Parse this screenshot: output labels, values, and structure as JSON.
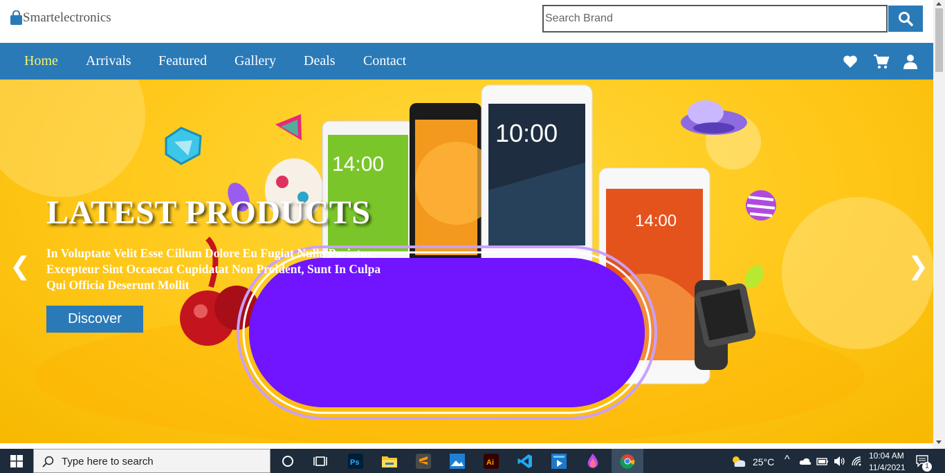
{
  "header": {
    "brand": "Smartelectronics",
    "search_placeholder": "Search Brand"
  },
  "nav": {
    "items": [
      {
        "label": "Home",
        "active": true
      },
      {
        "label": "Arrivals",
        "active": false
      },
      {
        "label": "Featured",
        "active": false
      },
      {
        "label": "Gallery",
        "active": false
      },
      {
        "label": "Deals",
        "active": false
      },
      {
        "label": "Contact",
        "active": false
      }
    ],
    "icons": [
      "heart-icon",
      "cart-icon",
      "user-icon"
    ]
  },
  "hero": {
    "title": "LATEST PRODUCTS",
    "subtitle": "In Voluptate Velit Esse Cillum Dolore Eu Fugiat Nulla Pariatur. Excepteur Sint Occaecat Cupidatat Non Proident, Sunt In Culpa Qui Officia Deserunt Mollit",
    "button": "Discover",
    "prev": "❮",
    "next": "❯",
    "phone_times": [
      "14:00",
      "10:00",
      "14:00"
    ]
  },
  "taskbar": {
    "search_placeholder": "Type here to search",
    "weather": "25°C",
    "time": "10:04 AM",
    "date": "11/4/2021",
    "notifications": "1"
  },
  "colors": {
    "brand_blue": "#2a7ab8",
    "active_nav": "#f3f36a",
    "hero_yellow": "#ffc81a",
    "taskbar": "#1d2b3a"
  }
}
